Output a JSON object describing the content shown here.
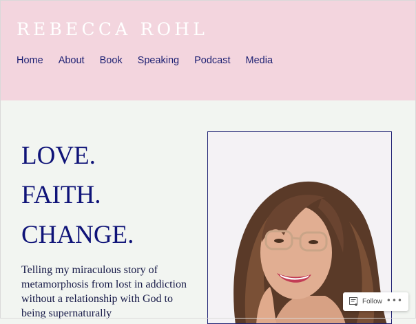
{
  "site": {
    "title": "REBECCA ROHL"
  },
  "nav": [
    {
      "label": "Home"
    },
    {
      "label": "About"
    },
    {
      "label": "Book"
    },
    {
      "label": "Speaking"
    },
    {
      "label": "Podcast"
    },
    {
      "label": "Media"
    }
  ],
  "hero": {
    "lines": [
      "LOVE.",
      "FAITH.",
      "CHANGE."
    ],
    "intro": "Telling my miraculous story of metamorphosis from lost in addiction without a relationship with God to being supernaturally"
  },
  "follow": {
    "label": "Follow",
    "more": "•••",
    "icon": "reader-follow-icon"
  },
  "colors": {
    "header_bg": "#f3d5de",
    "accent": "#1c1f72",
    "page_bg": "#f2f5f1"
  }
}
